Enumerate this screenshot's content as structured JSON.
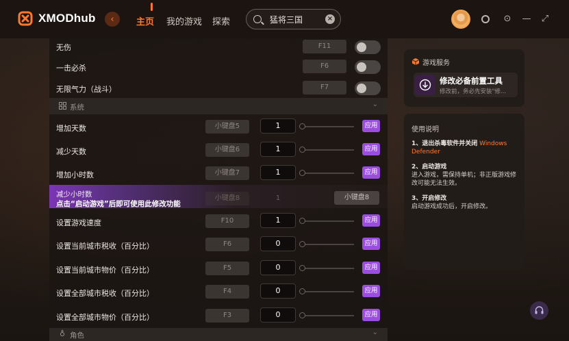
{
  "header": {
    "app_name": "XMODhub",
    "nav": [
      {
        "label": "主页",
        "active": true
      },
      {
        "label": "我的游戏",
        "active": false
      },
      {
        "label": "探索",
        "active": false
      }
    ],
    "search_value": "猛将三国",
    "accent_color": "#ff7a2e"
  },
  "toggles": [
    {
      "label": "无伤",
      "hotkey": "F11",
      "enabled": false
    },
    {
      "label": "一击必杀",
      "hotkey": "F6",
      "enabled": false
    },
    {
      "label": "无限气力（战斗）",
      "hotkey": "F7",
      "enabled": false
    }
  ],
  "section_system": {
    "label": "系统",
    "icon": "grid-icon"
  },
  "numeric_rows_a": [
    {
      "label": "增加天数",
      "hotkey": "小键盘5",
      "value": "1",
      "apply": "应用"
    },
    {
      "label": "减少天数",
      "hotkey": "小键盘6",
      "value": "1",
      "apply": "应用"
    },
    {
      "label": "增加小时数",
      "hotkey": "小键盘7",
      "value": "1",
      "apply": "应用"
    }
  ],
  "highlight_row": {
    "label": "减少小时数",
    "notice": "点击“启动游戏”后即可使用此修改功能",
    "ghost_hotkey": "小键盘8",
    "ghost_value": "1",
    "hotkey": "小键盘8"
  },
  "numeric_rows_b": [
    {
      "label": "设置游戏速度",
      "hotkey": "F10",
      "value": "1",
      "apply": "应用"
    },
    {
      "label": "设置当前城市税收（百分比）",
      "hotkey": "F6",
      "value": "0",
      "apply": "应用"
    },
    {
      "label": "设置当前城市物价（百分比）",
      "hotkey": "F5",
      "value": "0",
      "apply": "应用"
    },
    {
      "label": "设置全部城市税收（百分比）",
      "hotkey": "F4",
      "value": "0",
      "apply": "应用"
    },
    {
      "label": "设置全部城市物价（百分比）",
      "hotkey": "F3",
      "value": "0",
      "apply": "应用"
    }
  ],
  "section_role": {
    "label": "角色",
    "icon": "person-icon"
  },
  "service_card": {
    "title": "游戏服务",
    "item_title": "修改必备前置工具",
    "item_sub": "修改前，务必先安装\"修..."
  },
  "guide": {
    "title": "使用说明",
    "steps": [
      {
        "head": "1、退出杀毒软件并关闭",
        "accent": "Windows Defender",
        "body": ""
      },
      {
        "head": "2、启动游戏",
        "accent": "",
        "body": "进入游戏，需保持单机；非正版游戏修改可能无法生效。"
      },
      {
        "head": "3、开启修改",
        "accent": "",
        "body": "启动游戏成功后，开启修改。"
      }
    ]
  },
  "apply_color": "#9b4de0"
}
